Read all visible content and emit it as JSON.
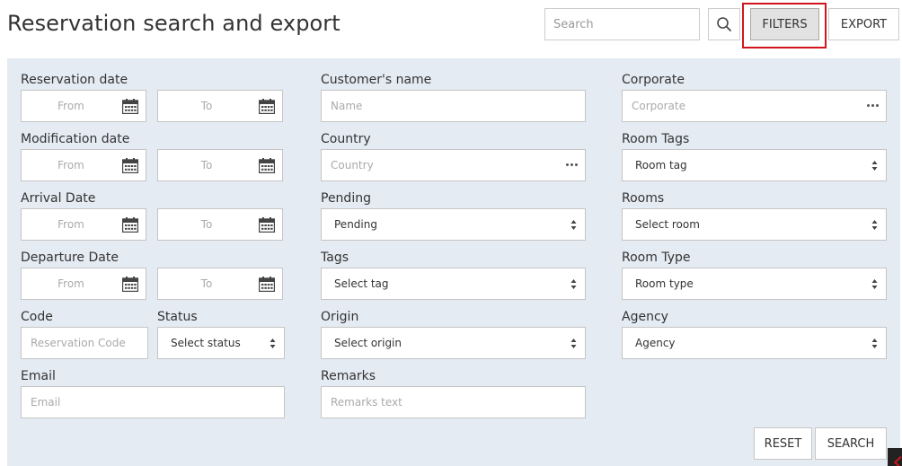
{
  "header": {
    "title": "Reservation search and export",
    "search_placeholder": "Search",
    "filters_label": "FILTERS",
    "export_label": "EXPORT"
  },
  "icons": {
    "search": "search-icon",
    "calendar": "calendar-icon",
    "more": "more-dots-icon",
    "sort": "sort-arrows-icon"
  },
  "colors": {
    "panel_bg": "#e5ebf3",
    "highlight": "#d0161c",
    "filters_active_bg": "#e2e2e2"
  },
  "filters": {
    "reservation_date": {
      "label": "Reservation date",
      "from": "From",
      "to": "To"
    },
    "modification_date": {
      "label": "Modification date",
      "from": "From",
      "to": "To"
    },
    "arrival_date": {
      "label": "Arrival Date",
      "from": "From",
      "to": "To"
    },
    "departure_date": {
      "label": "Departure Date",
      "from": "From",
      "to": "To"
    },
    "code": {
      "label": "Code",
      "placeholder": "Reservation Code"
    },
    "status": {
      "label": "Status",
      "value": "Select status"
    },
    "email": {
      "label": "Email",
      "placeholder": "Email"
    },
    "customer_name": {
      "label": "Customer's name",
      "placeholder": "Name"
    },
    "country": {
      "label": "Country",
      "placeholder": "Country"
    },
    "pending": {
      "label": "Pending",
      "value": "Pending"
    },
    "tags": {
      "label": "Tags",
      "value": "Select tag"
    },
    "origin": {
      "label": "Origin",
      "value": "Select origin"
    },
    "remarks": {
      "label": "Remarks",
      "placeholder": "Remarks text"
    },
    "corporate": {
      "label": "Corporate",
      "placeholder": "Corporate"
    },
    "room_tags": {
      "label": "Room Tags",
      "value": "Room tag"
    },
    "rooms": {
      "label": "Rooms",
      "value": "Select room"
    },
    "room_type": {
      "label": "Room Type",
      "value": "Room type"
    },
    "agency": {
      "label": "Agency",
      "value": "Agency"
    }
  },
  "actions": {
    "reset_label": "RESET",
    "search_label": "SEARCH"
  }
}
